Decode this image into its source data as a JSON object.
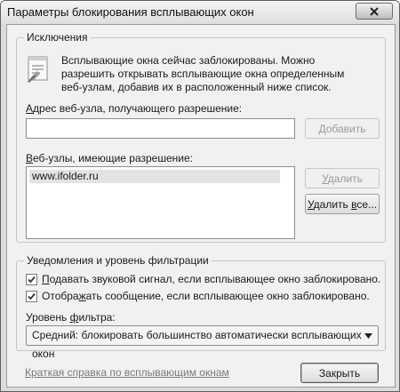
{
  "window": {
    "title": "Параметры блокирования всплывающих окон"
  },
  "exceptions": {
    "group_title": "Исключения",
    "info_text": "Всплывающие окна сейчас заблокированы.  Можно разрешить открывать всплывающие окна определенным веб-узлам, добавив их в расположенный ниже список.",
    "address_label": "Адрес веб-узла, получающего разрешение:",
    "address_value": "",
    "add_button": "Добавить",
    "allowed_label": "Веб-узлы, имеющие разрешение:",
    "allowed_sites": [
      "www.ifolder.ru"
    ],
    "remove_button": "Удалить",
    "remove_all_button": "Удалить все..."
  },
  "notifications": {
    "group_title": "Уведомления и  уровень фильтрации",
    "sound_checkbox": {
      "label": "Подавать звуковой сигнал, если всплывающее окно заблокировано.",
      "checked": true
    },
    "message_checkbox": {
      "label": "Отображать сообщение, если всплывающее окно заблокировано.",
      "checked": true
    },
    "filter_label": "Уровень фильтра:",
    "filter_value": "Средний: блокировать большинство автоматически всплывающих окон"
  },
  "footer": {
    "help_link": "Краткая справка по всплывающим окнам",
    "close_button": "Закрыть"
  },
  "icons": {
    "info": "notepad-icon",
    "check": "checkmark-icon",
    "dropdown": "triangle-down-icon",
    "close": "x-icon"
  }
}
